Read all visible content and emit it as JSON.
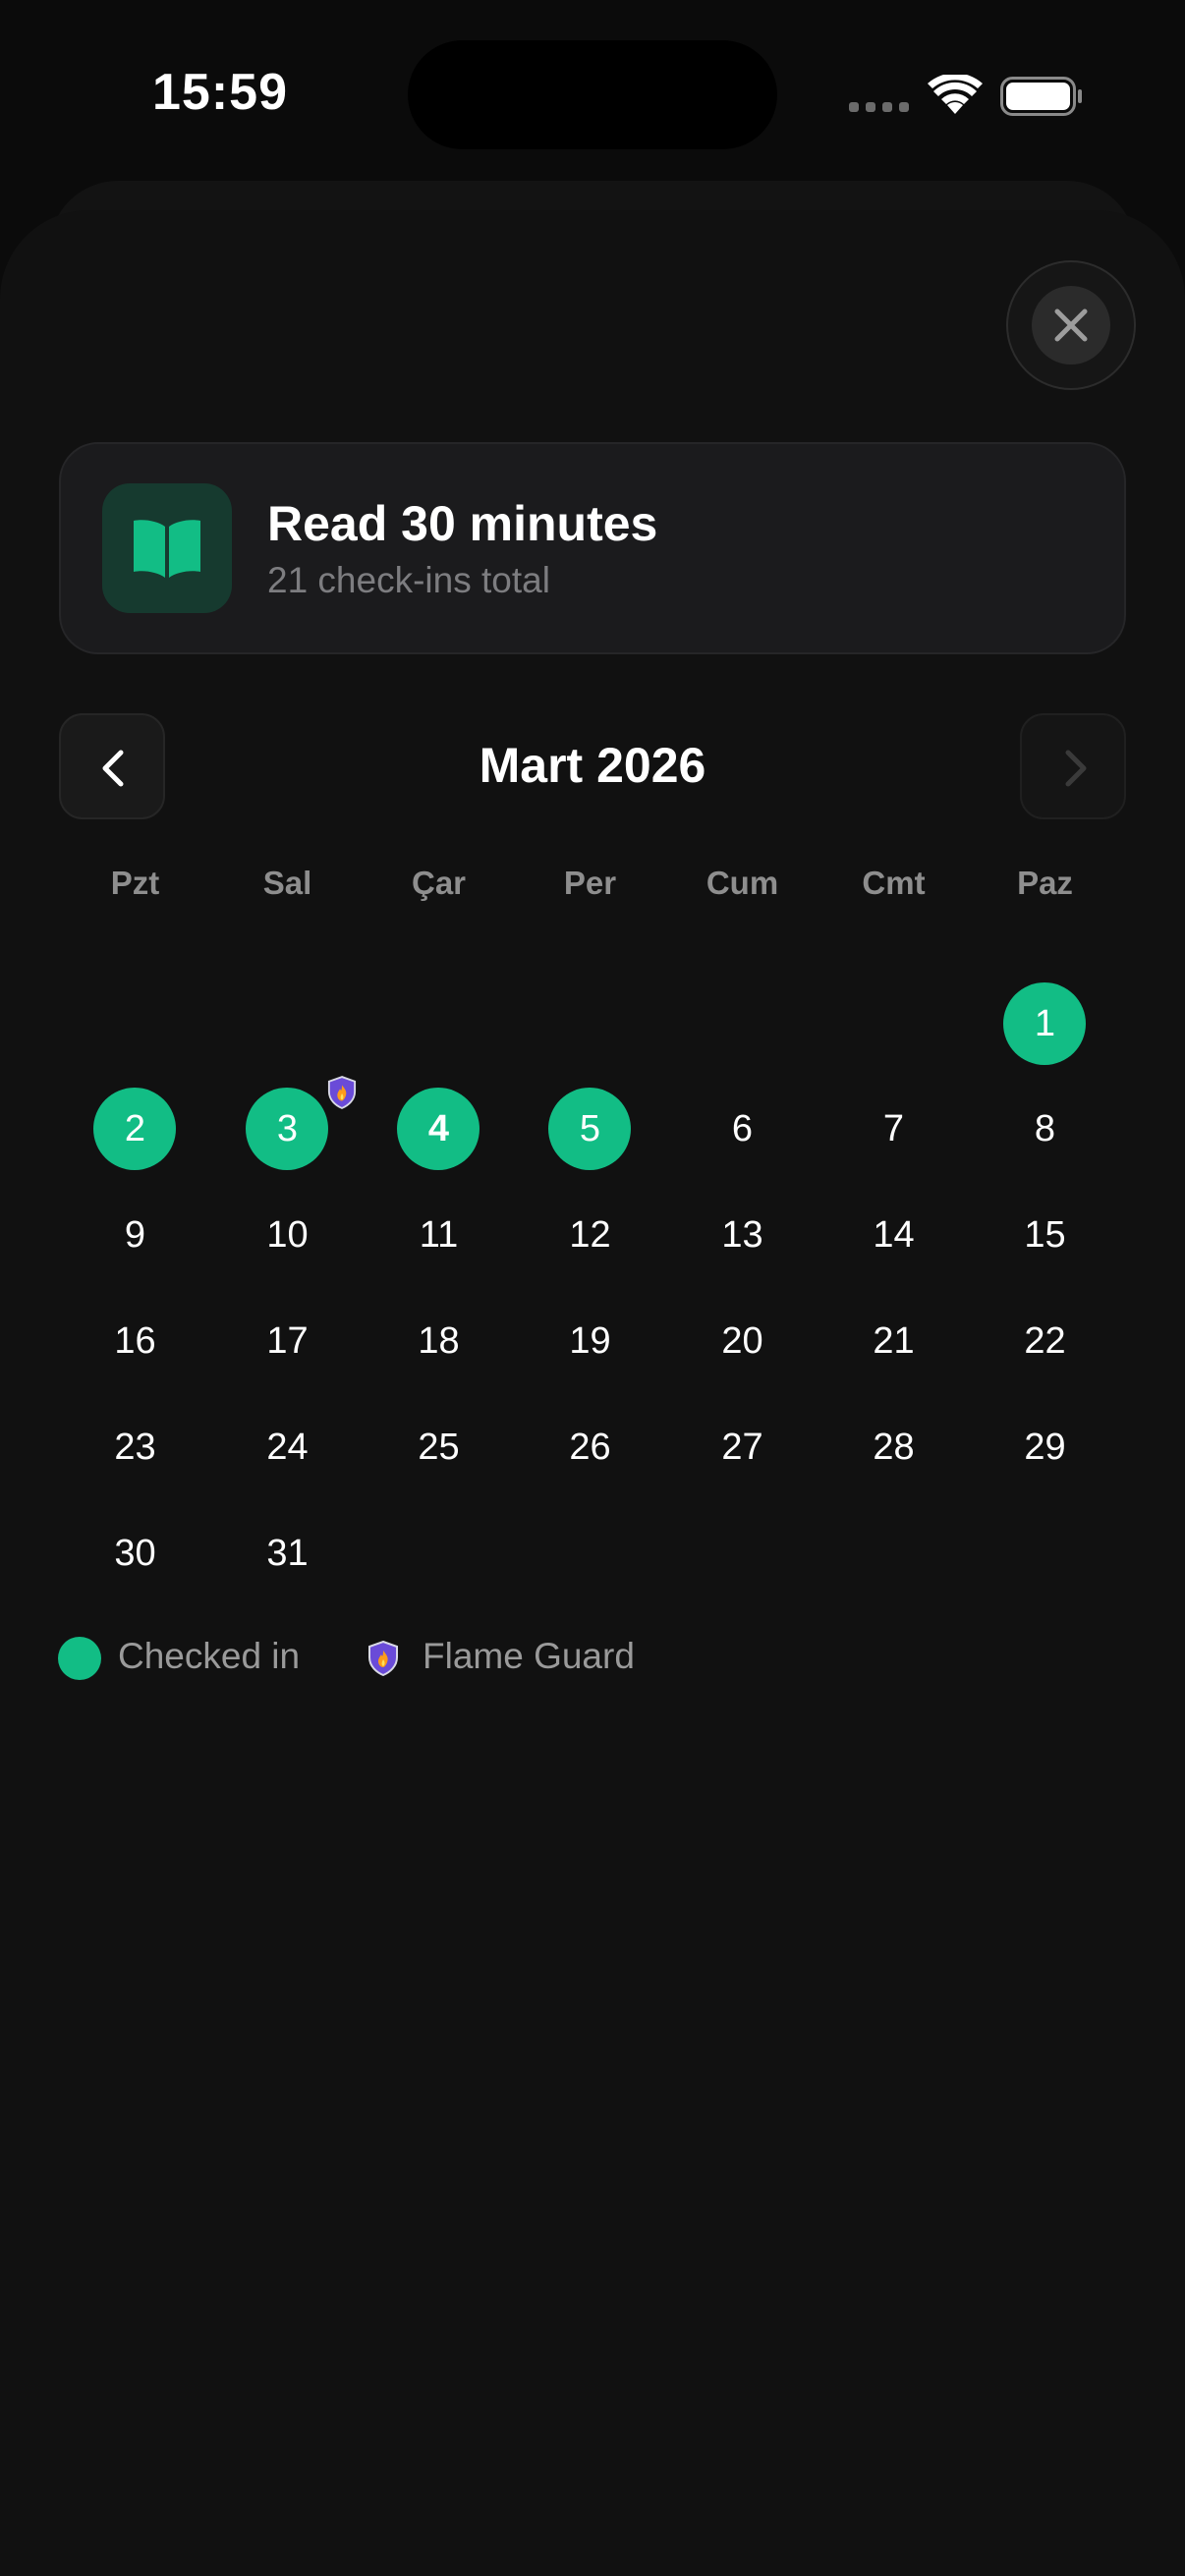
{
  "status_bar": {
    "time": "15:59"
  },
  "habit": {
    "title": "Read 30 minutes",
    "subtitle": "21 check-ins total",
    "icon": "book-icon"
  },
  "calendar": {
    "month_title": "Mart 2026",
    "weekdays": [
      "Pzt",
      "Sal",
      "Çar",
      "Per",
      "Cum",
      "Cmt",
      "Paz"
    ],
    "first_weekday_index": 6,
    "days_in_month": 31,
    "checked_days": [
      1,
      2,
      3,
      4,
      5
    ],
    "today": 4,
    "flame_guard_days": [
      3
    ]
  },
  "legend": {
    "checked_label": "Checked in",
    "guard_label": "Flame Guard"
  },
  "colors": {
    "accent": "#12bd85",
    "background": "#111111",
    "card": "#1b1b1d"
  }
}
